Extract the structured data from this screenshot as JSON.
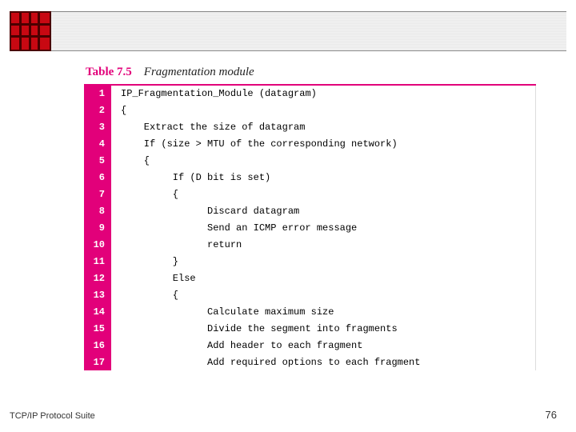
{
  "caption": {
    "number": "Table 7.5",
    "title": "Fragmentation module"
  },
  "code": {
    "lines": [
      "IP_Fragmentation_Module (datagram)",
      "{",
      "    Extract the size of datagram",
      "    If (size > MTU of the corresponding network)",
      "    {",
      "         If (D bit is set)",
      "         {",
      "               Discard datagram",
      "               Send an ICMP error message",
      "               return",
      "         }",
      "         Else",
      "         {",
      "               Calculate maximum size",
      "               Divide the segment into fragments",
      "               Add header to each fragment",
      "               Add required options to each fragment"
    ]
  },
  "footer": {
    "left": "TCP/IP Protocol Suite",
    "right": "76"
  }
}
